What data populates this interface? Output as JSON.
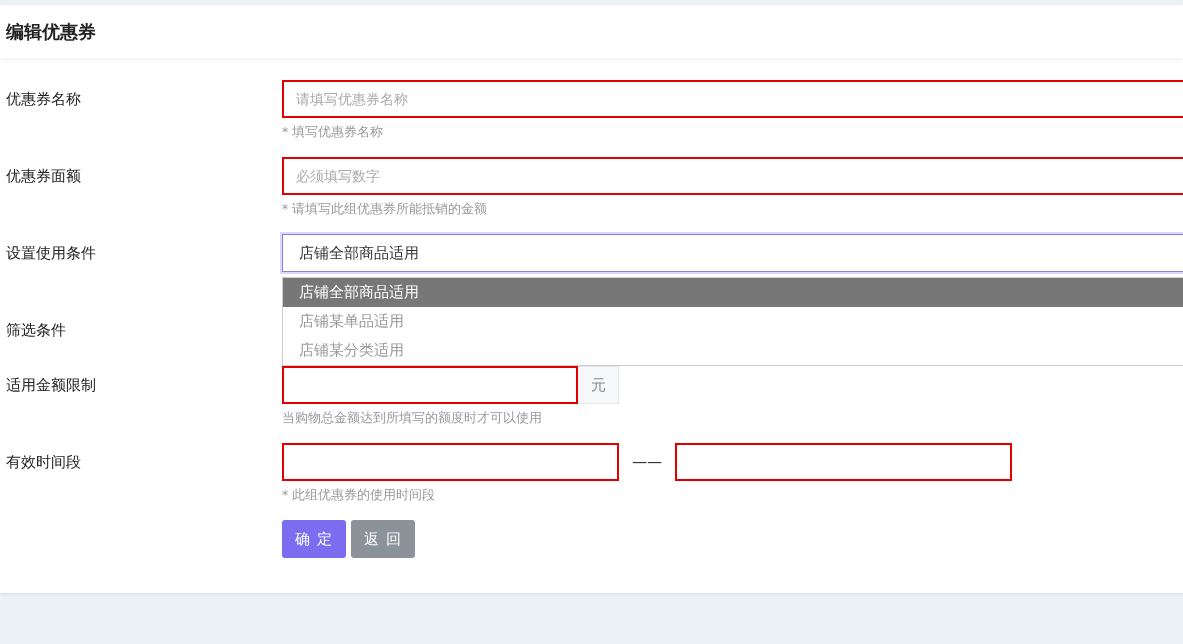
{
  "page_title": "编辑优惠券",
  "fields": [
    {
      "kind": "text",
      "label": "优惠券名称",
      "placeholder": "请填写优惠券名称",
      "help": "* 填写优惠券名称"
    },
    {
      "kind": "text",
      "label": "优惠券面额",
      "placeholder": "必须填写数字",
      "help": "* 请填写此组优惠券所能抵销的金额"
    },
    {
      "kind": "select",
      "label": "设置使用条件",
      "value": "店铺全部商品适用",
      "expanded": true,
      "options": [
        {
          "label": "店铺全部商品适用",
          "selected": true
        },
        {
          "label": "店铺某单品适用",
          "selected": false
        },
        {
          "label": "店铺某分类适用",
          "selected": false
        }
      ]
    },
    {
      "kind": "hidden",
      "label": "筛选条件"
    },
    {
      "kind": "amount",
      "label": "适用金额限制",
      "unit": "元",
      "help": "当购物总金额达到所填写的额度时才可以使用"
    },
    {
      "kind": "range",
      "label": "有效时间段",
      "separator": "——",
      "help": "* 此组优惠券的使用时间段"
    }
  ],
  "buttons": [
    {
      "kind": "primary",
      "label": "确 定"
    },
    {
      "kind": "secondary",
      "label": "返 回"
    }
  ]
}
